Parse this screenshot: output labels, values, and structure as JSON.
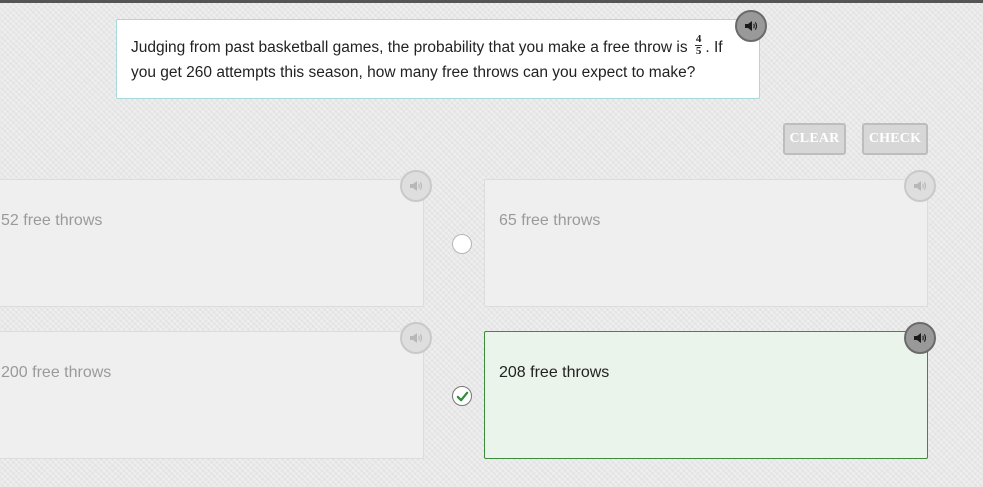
{
  "question": {
    "text_before": "Judging from past basketball games, the probability that you make a free throw is",
    "fraction": {
      "numerator": "4",
      "denominator": "5"
    },
    "text_after": ". If you get 260 attempts this season, how many free throws can you expect to make?"
  },
  "toolbar": {
    "clear_label": "CLEAR",
    "check_label": "CHECK"
  },
  "options": [
    {
      "label": "52 free throws",
      "selected": false
    },
    {
      "label": "65 free throws",
      "selected": false
    },
    {
      "label": "200 free throws",
      "selected": false
    },
    {
      "label": "208 free throws",
      "selected": true
    }
  ],
  "icons": {
    "audio": "speaker-icon",
    "selected_mark": "checkmark-icon"
  },
  "colors": {
    "selected_border": "#3c8c3c",
    "selected_background": "#eaf4ea",
    "question_border": "#a9d8df"
  }
}
